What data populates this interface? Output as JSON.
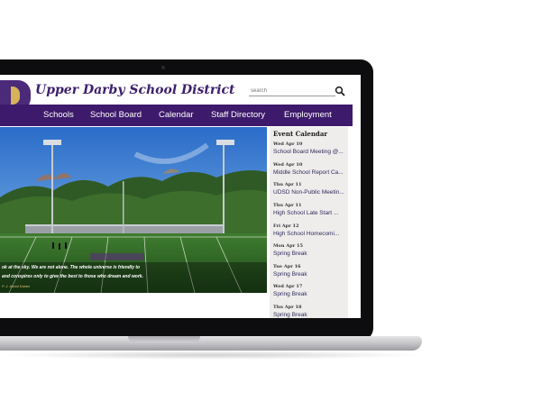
{
  "site": {
    "title": "Upper Darby School District",
    "search_placeholder": "search"
  },
  "nav": {
    "items": [
      "Schools",
      "School Board",
      "Calendar",
      "Staff Directory",
      "Employment"
    ]
  },
  "hero": {
    "quote_lines": [
      "ok at the sky. We are not alone. The whole universe is friendly to",
      "and conspires only to give the best to those who dream and work."
    ],
    "quote_author": "P. J. Abdul Kalam"
  },
  "calendar": {
    "title": "Event Calendar",
    "events": [
      {
        "date": "Wed Apr 10",
        "title": "School Board Meeting @..."
      },
      {
        "date": "Wed Apr 10",
        "title": "Middle School Report Ca..."
      },
      {
        "date": "Thu Apr 11",
        "title": "UDSD Non-Public Meetin..."
      },
      {
        "date": "Thu Apr 11",
        "title": "High School Late Start ..."
      },
      {
        "date": "Fri Apr 12",
        "title": "High School Homecomi..."
      },
      {
        "date": "Mon Apr 15",
        "title": "Spring Break"
      },
      {
        "date": "Tue Apr 16",
        "title": "Spring Break"
      },
      {
        "date": "Wed Apr 17",
        "title": "Spring Break"
      },
      {
        "date": "Thu Apr 18",
        "title": "Spring Break"
      }
    ]
  },
  "colors": {
    "brand_purple": "#3d1a6b",
    "brand_gold": "#d6b25a"
  },
  "icons": {
    "search": "magnifier-icon"
  }
}
